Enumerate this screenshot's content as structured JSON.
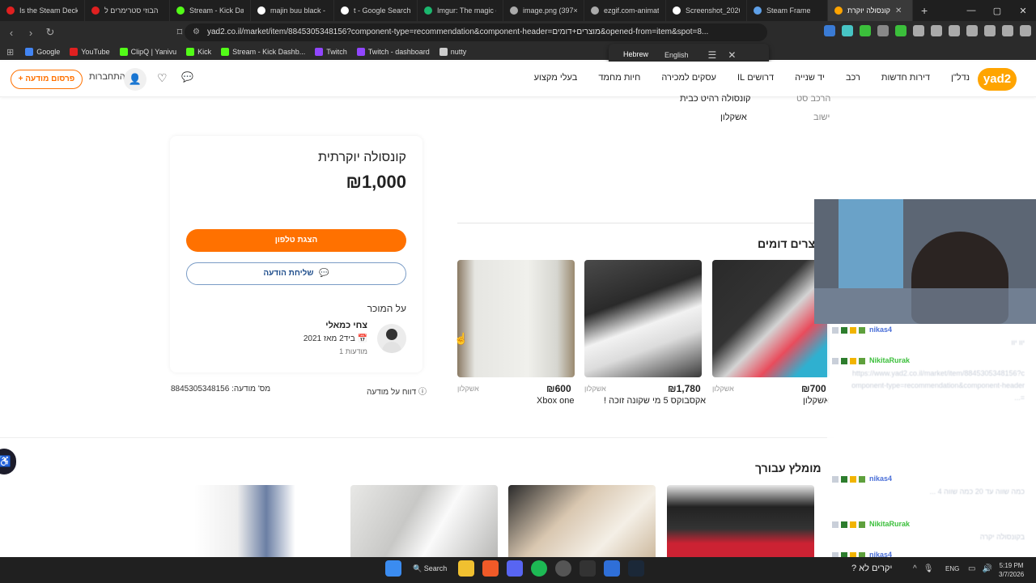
{
  "browser": {
    "tabs": [
      {
        "title": "Is the Steam Deck G",
        "color": "#e02020"
      },
      {
        "title": "הבוזי סטרימרים ל",
        "color": "#e02020"
      },
      {
        "title": "Stream - Kick Dashb",
        "color": "#53fc18"
      },
      {
        "title": "majin buu black - G",
        "color": "#ffffff"
      },
      {
        "title": "t - Google Search",
        "color": "#ffffff"
      },
      {
        "title": "Imgur: The magic o",
        "color": "#1bb76e"
      },
      {
        "title": "image.png (397×38",
        "color": "#aaaaaa"
      },
      {
        "title": "ezgif.com-animated",
        "color": "#aaaaaa"
      },
      {
        "title": "Screenshot_2026-0",
        "color": "#ffffff"
      },
      {
        "title": "Steam Frame",
        "color": "#5ea0e8"
      },
      {
        "title": "קונסולה יוקרת",
        "color": "#ffa400",
        "active": true
      }
    ],
    "url": "yad2.co.il/market/item/8845305348156?component-type=recommendation&component-header=מוצרים+דומים&opened-from=item&spot=8...",
    "bookmarks": [
      {
        "label": "Google",
        "color": "#4285f4"
      },
      {
        "label": "YouTube",
        "color": "#e02020"
      },
      {
        "label": "ClipQ | Yanivu",
        "color": "#53fc18"
      },
      {
        "label": "Kick",
        "color": "#53fc18"
      },
      {
        "label": "Stream - Kick Dashb...",
        "color": "#53fc18"
      },
      {
        "label": "Twitch",
        "color": "#9146ff"
      },
      {
        "label": "Twitch - dashboard",
        "color": "#9146ff"
      },
      {
        "label": "nutty",
        "color": "#cccccc"
      }
    ],
    "translate": {
      "lang1": "Hebrew",
      "lang2": "English"
    }
  },
  "header": {
    "post_ad": "+ פרסום מודעה",
    "login": "התחברות",
    "nav": [
      "נדל\"ן",
      "דירות חדשות",
      "רכב",
      "יד שנייה",
      "דרושים IL",
      "עסקים למכירה",
      "חיות מחמד",
      "בעלי מקצוע"
    ],
    "logo": "yad2"
  },
  "specs": [
    {
      "key": "הרכב סט",
      "value": "קונסולה רהיט כבית"
    },
    {
      "key": "ישוב",
      "value": "אשקלון"
    }
  ],
  "card": {
    "title": "קונסולה יוקרתית",
    "price": "₪1,000",
    "phone_btn": "הצגת טלפון",
    "msg_btn": "שליחת הודעה",
    "about_seller": "על המוכר",
    "seller_name": "צחי כמאלי",
    "seller_since": "ביד2 מאז 2021",
    "seller_ads": "1 מודעות"
  },
  "ad_number": "מס' מודעה: 8845305348156",
  "report": "דווח על מודעה",
  "similar": {
    "title": "מוצרים דומים",
    "items": [
      {
        "price": "₪700",
        "location": "אשקלון",
        "name": "אשקלון"
      },
      {
        "price": "₪1,780",
        "location": "אשקלון",
        "name": "אקסבוקס 5 מי שקונה זוכה !"
      },
      {
        "price": "₪600",
        "location": "אשקלון",
        "name": "Xbox one"
      }
    ]
  },
  "recommended": {
    "title": "מומלץ עבורך"
  },
  "chat": [
    {
      "user": "nikas4",
      "color": "#4a6fd8",
      "msg": "יוו יוו"
    },
    {
      "user": "NikitaRurak",
      "color": "#3bbf3b",
      "msg": "https://www.yad2.co.il/market/item/8845305348156?component-type=recommendation&component-header=..."
    },
    {
      "user": "nikas4",
      "color": "#4a6fd8",
      "msg": "כמה שווה עד 20 כמה שווה 4 ..."
    },
    {
      "user": "NikitaRurak",
      "color": "#3bbf3b",
      "msg": "בקונסולה יקרה"
    },
    {
      "user": "nikas4",
      "color": "#4a6fd8",
      "msg": ""
    }
  ],
  "taskbar": {
    "search": "Search",
    "notification": "? יקרים לא",
    "lang": "ENG",
    "time": "5:19 PM",
    "date": "3/7/2026"
  }
}
